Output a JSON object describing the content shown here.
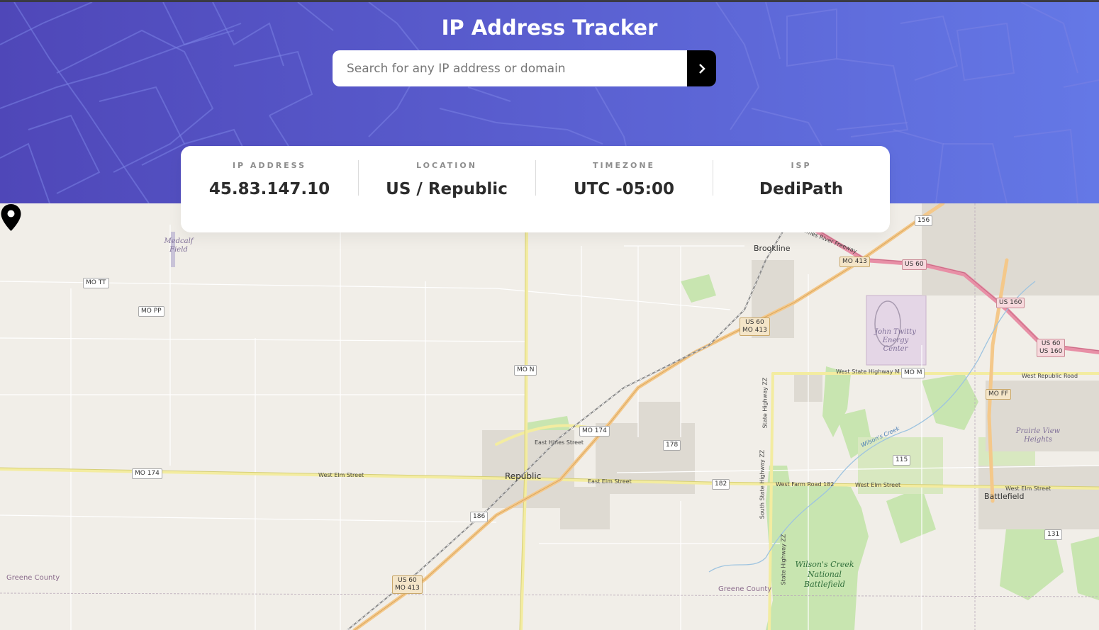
{
  "app": {
    "title": "IP Address Tracker"
  },
  "search": {
    "placeholder": "Search for any IP address or domain",
    "value": "",
    "submit_icon": "chevron-right-icon"
  },
  "info": {
    "items": [
      {
        "label": "IP Address",
        "value": "45.83.147.10"
      },
      {
        "label": "Location",
        "value": "US / Republic"
      },
      {
        "label": "Timezone",
        "value": "UTC -05:00"
      },
      {
        "label": "ISP",
        "value": "DediPath"
      }
    ]
  },
  "map": {
    "marker_icon": "location-pin-icon",
    "places": {
      "republic": "Republic",
      "brookline": "Brookline",
      "battlefield": "Battlefield",
      "prairie_view": "Prairie View Heights",
      "medcalf": "Medcalf Field",
      "energy_center": "John Twitty Energy Center",
      "wilsons_creek": "Wilson's Creek National Battlefield",
      "wilsons_creek_river": "Wilson's Creek",
      "greene_county_1": "Greene County",
      "greene_county_2": "Greene County"
    },
    "streets": {
      "west_elm": "West Elm Street",
      "east_elm": "East Elm Street",
      "east_hines": "East Hines Street",
      "west_farm": "West Farm Road 182",
      "west_elm_2": "West Elm Street",
      "west_elm_3": "West Elm Street",
      "west_state_hwy": "West State Highway M",
      "west_republic": "West Republic Road",
      "state_hwy_zz": "State Highway ZZ",
      "south_state_hwy_zz": "South State Highway ZZ",
      "state_hwy_zz_2": "State Highway ZZ",
      "james_river": "James River Freeway"
    },
    "shields": {
      "mo_tt": "MO TT",
      "mo_pp": "MO PP",
      "mo_n": "MO N",
      "mo_174_w": "MO 174",
      "mo_174_e": "MO 174",
      "us60_mo413_a_1": "US 60",
      "us60_mo413_a_2": "MO 413",
      "us60_mo413_b_1": "US 60",
      "us60_mo413_b_2": "MO 413",
      "mo_413": "MO 413",
      "us_60": "US 60",
      "us_160": "US 160",
      "us60_us160_1": "US 60",
      "us60_us160_2": "US 160",
      "mo_m": "MO M",
      "mo_ff": "MO FF",
      "r156": "156",
      "r178": "178",
      "r182": "182",
      "r186": "186",
      "r115": "115",
      "r131": "131"
    }
  },
  "colors": {
    "header_start": "#4f47b8",
    "header_end": "#6478e6",
    "card_bg": "#ffffff",
    "label_gray": "#8d8d8d",
    "value_dark": "#2b2b2b",
    "button_bg": "#000000"
  }
}
